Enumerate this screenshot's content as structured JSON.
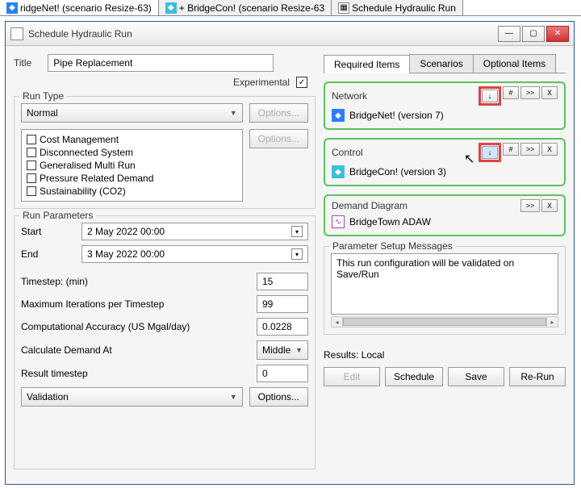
{
  "top_tabs": [
    {
      "label": "ridgeNet! (scenario Resize-63)",
      "icon": "blue"
    },
    {
      "label": "+ BridgeCon! (scenario Resize-63",
      "icon": "cyan"
    },
    {
      "label": "Schedule Hydraulic Run",
      "icon": "gray"
    }
  ],
  "window": {
    "title": "Schedule Hydraulic Run"
  },
  "form": {
    "title_label": "Title",
    "title_value": "Pipe Replacement",
    "experimental_label": "Experimental",
    "experimental_checked": "✓",
    "run_type_legend": "Run Type",
    "run_type_value": "Normal",
    "options_label": "Options...",
    "flags": [
      "Cost Management",
      "Disconnected System",
      "Generalised Multi Run",
      "Pressure Related Demand",
      "Sustainability (CO2)"
    ]
  },
  "params": {
    "legend": "Run Parameters",
    "start_label": "Start",
    "start_value": "2     May     2022  00:00",
    "end_label": "End",
    "end_value": "3     May     2022  00:00",
    "timestep_label": "Timestep: (min)",
    "timestep_value": "15",
    "maxiter_label": "Maximum Iterations per Timestep",
    "maxiter_value": "99",
    "accuracy_label": "Computational Accuracy (US Mgal/day)",
    "accuracy_value": "0.0228",
    "calcdemand_label": "Calculate Demand At",
    "calcdemand_value": "Middle",
    "result_ts_label": "Result timestep",
    "result_ts_value": "0",
    "validation_value": "Validation",
    "options_label": "Options..."
  },
  "tabs": {
    "required": "Required Items",
    "scenarios": "Scenarios",
    "optional": "Optional Items"
  },
  "cards": {
    "network": {
      "title": "Network",
      "body": "BridgeNet! (version 7)"
    },
    "control": {
      "title": "Control",
      "body": "BridgeCon! (version 3)"
    },
    "demand": {
      "title": "Demand Diagram",
      "body": "BridgeTown ADAW"
    }
  },
  "buttons": {
    "down": "↓",
    "hash": "#",
    "fwd": ">>",
    "x": "X"
  },
  "messages": {
    "legend": "Parameter Setup Messages",
    "text": "This run configuration will be validated on Save/Run"
  },
  "results": {
    "label": "Results: Local",
    "edit": "Edit",
    "schedule": "Schedule",
    "save": "Save",
    "rerun": "Re-Run"
  }
}
